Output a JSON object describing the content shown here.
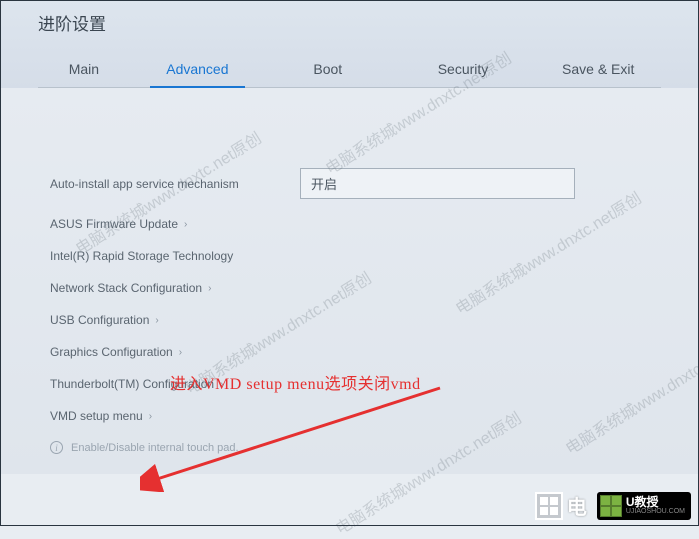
{
  "header": {
    "title": "进阶设置"
  },
  "tabs": [
    {
      "label": "Main",
      "active": false
    },
    {
      "label": "Advanced",
      "active": true
    },
    {
      "label": "Boot",
      "active": false
    },
    {
      "label": "Security",
      "active": false
    },
    {
      "label": "Save & Exit",
      "active": false
    }
  ],
  "option": {
    "label": "Auto-install app service mechanism",
    "value": "开启"
  },
  "menu_items": [
    "ASUS Firmware Update",
    "Intel(R) Rapid Storage Technology",
    "Network Stack Configuration",
    "USB Configuration",
    "Graphics Configuration",
    "Thunderbolt(TM) Configuration",
    "VMD setup menu"
  ],
  "hint": "Enable/Disable internal touch pad.",
  "annotation": "进入VMD setup menu选项关闭vmd",
  "watermark_text": "电脑系统城www.dnxtc.net原创",
  "logos": {
    "logo1": "电",
    "logo2_main": "U教授",
    "logo2_sub": "UJIAOSHOU.COM"
  }
}
